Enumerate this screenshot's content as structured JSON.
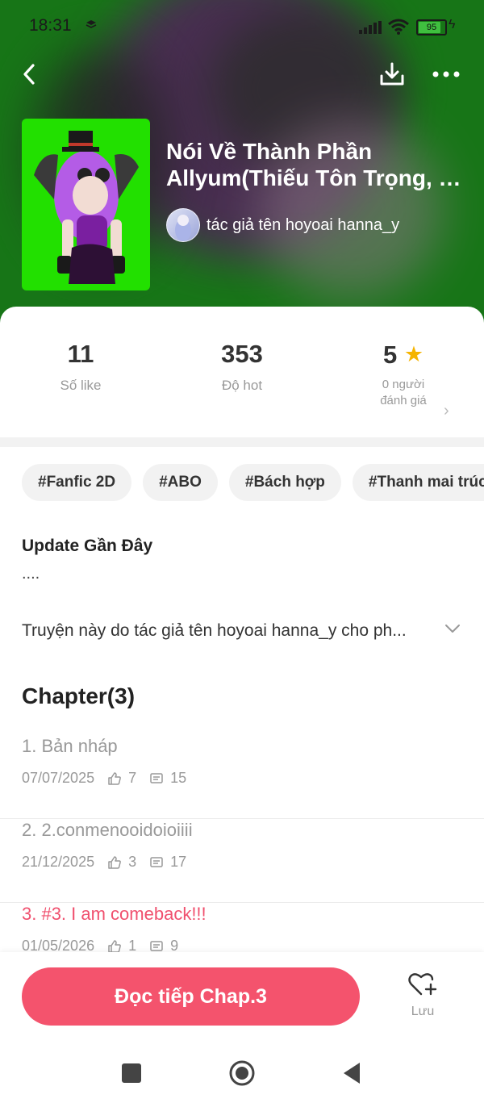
{
  "status": {
    "time": "18:31",
    "battery": "95",
    "battery_level": 0.95
  },
  "book": {
    "title": "Nói Về Thành Phần Allyum(Thiếu Tôn Trọng, …",
    "author": "tác giả tên hoyoai hanna_y"
  },
  "stats": {
    "likes_value": "11",
    "likes_label": "Số like",
    "hot_value": "353",
    "hot_label": "Độ hot",
    "rating_value": "5",
    "rating_label_line1": "0 người",
    "rating_label_line2": "đánh giá"
  },
  "tags": [
    "#Fanfic 2D",
    "#ABO",
    "#Bách hợp",
    "#Thanh mai trúc"
  ],
  "update": {
    "title": "Update Gần Đây",
    "body": "...."
  },
  "description": "Truyện này do tác giả tên hoyoai hanna_y cho ph...",
  "chapters_title": "Chapter(3)",
  "chapters": [
    {
      "name": "1. Bản nháp",
      "date": "07/07/2025",
      "likes": "7",
      "comments": "15",
      "current": false
    },
    {
      "name": "2. 2.conmenooidoioiiii",
      "date": "21/12/2025",
      "likes": "3",
      "comments": "17",
      "current": false
    },
    {
      "name": "3. #3. I am comeback!!!",
      "date": "01/05/2026",
      "likes": "1",
      "comments": "9",
      "current": true
    }
  ],
  "actions": {
    "read_label": "Đọc tiếp Chap.3",
    "save_label": "Lưu"
  },
  "colors": {
    "accent": "#f4536d",
    "current_chapter": "#f0506e",
    "star": "#f5b400",
    "cover_bg": "#22e000"
  },
  "icons": {
    "back": "chevron-left-icon",
    "download": "download-icon",
    "more": "more-dots-icon",
    "star": "star-icon",
    "like": "thumb-up-icon",
    "comment": "comment-icon",
    "save": "heart-plus-icon",
    "expand": "chevron-down-icon"
  }
}
